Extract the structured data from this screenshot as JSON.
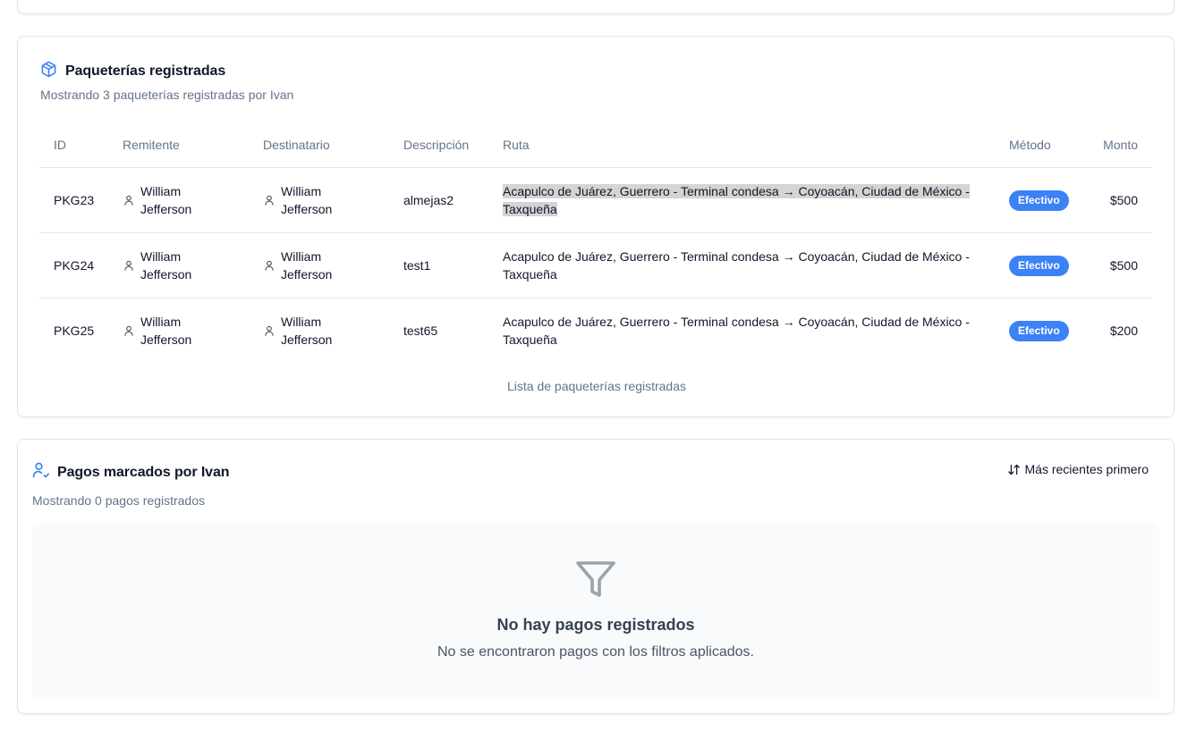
{
  "packages": {
    "title": "Paqueterías registradas",
    "subtitle": "Mostrando 3 paqueterías registradas por Ivan",
    "columns": {
      "id": "ID",
      "sender": "Remitente",
      "recipient": "Destinatario",
      "description": "Descripción",
      "route": "Ruta",
      "method": "Método",
      "amount": "Monto"
    },
    "rows": [
      {
        "id": "PKG23",
        "sender": "William Jefferson",
        "recipient": "William Jefferson",
        "description": "almejas2",
        "route": "Acapulco de Juárez, Guerrero - Terminal condesa → Coyoacán, Ciudad de México - Taxqueña",
        "method": "Efectivo",
        "amount": "$500"
      },
      {
        "id": "PKG24",
        "sender": "William Jefferson",
        "recipient": "William Jefferson",
        "description": "test1",
        "route": "Acapulco de Juárez, Guerrero - Terminal condesa → Coyoacán, Ciudad de México - Taxqueña",
        "method": "Efectivo",
        "amount": "$500"
      },
      {
        "id": "PKG25",
        "sender": "William Jefferson",
        "recipient": "William Jefferson",
        "description": "test65",
        "route": "Acapulco de Juárez, Guerrero - Terminal condesa → Coyoacán, Ciudad de México - Taxqueña",
        "method": "Efectivo",
        "amount": "$200"
      }
    ],
    "caption": "Lista de paqueterías registradas",
    "icon": "package-icon"
  },
  "payments": {
    "title": "Pagos marcados por Ivan",
    "subtitle": "Mostrando 0 pagos registrados",
    "sort_label": "Más recientes primero",
    "empty_title": "No hay pagos registrados",
    "empty_message": "No se encontraron pagos con los filtros aplicados.",
    "icon": "user-check-icon"
  },
  "colors": {
    "accent": "#3b82f6",
    "badge_bg": "#3b82f6",
    "muted_text": "#64748b",
    "border": "#e2e4e8"
  }
}
